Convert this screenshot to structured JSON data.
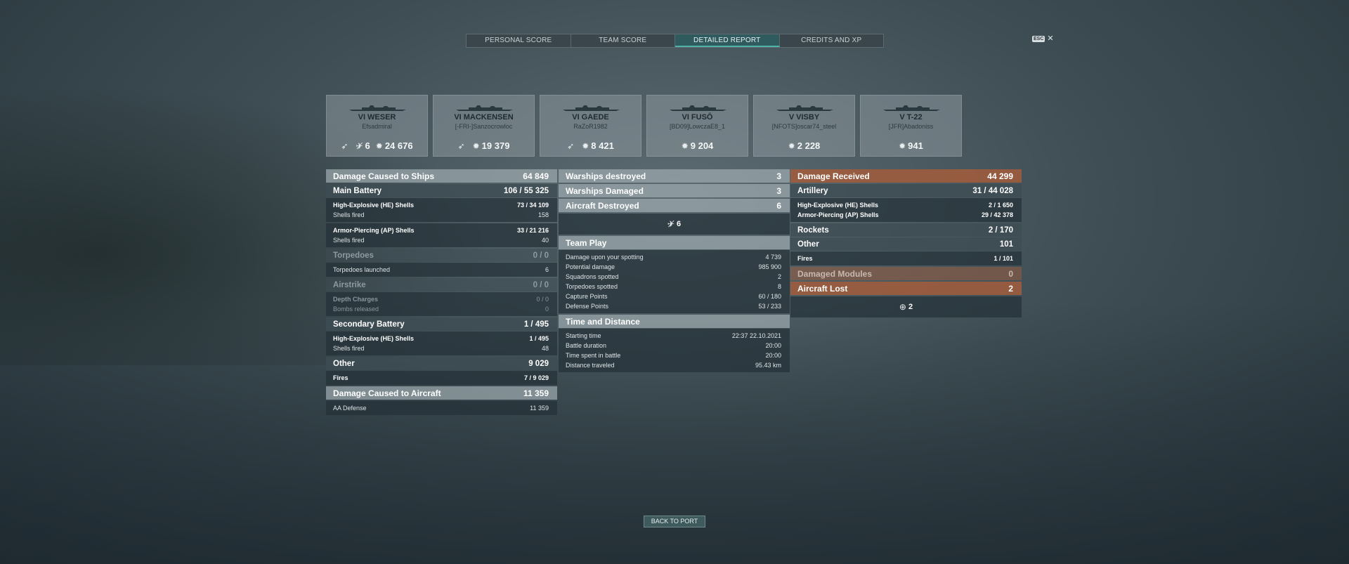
{
  "tabs": {
    "personal": "PERSONAL SCORE",
    "team": "TEAM SCORE",
    "detailed": "DETAILED REPORT",
    "credits": "CREDITS AND XP"
  },
  "esc": {
    "key": "ESC",
    "icon": "close-icon"
  },
  "ships": [
    {
      "tier": "VI",
      "name": "WESER",
      "player": "Efsadmiral",
      "stats": [
        {
          "icon": "torpedo-icon",
          "value": ""
        },
        {
          "icon": "plane-destroyed-icon",
          "value": "6"
        },
        {
          "icon": "damage-icon",
          "value": "24 676"
        }
      ]
    },
    {
      "tier": "VI",
      "name": "MACKENSEN",
      "player": "[-FRI-]Sanzocrowloc",
      "stats": [
        {
          "icon": "torpedo-icon",
          "value": ""
        },
        {
          "icon": "damage-icon",
          "value": "19 379"
        }
      ]
    },
    {
      "tier": "VI",
      "name": "GAEDE",
      "player": "RaZoR1982",
      "stats": [
        {
          "icon": "torpedo-icon",
          "value": ""
        },
        {
          "icon": "damage-icon",
          "value": "8 421"
        }
      ]
    },
    {
      "tier": "VI",
      "name": "FUSŌ",
      "player": "[BD09]LowczaE8_1",
      "stats": [
        {
          "icon": "damage-icon",
          "value": "9 204"
        }
      ]
    },
    {
      "tier": "V",
      "name": "VISBY",
      "player": "[NFOTS]oscar74_steel",
      "stats": [
        {
          "icon": "damage-icon",
          "value": "2 228"
        }
      ]
    },
    {
      "tier": "V",
      "name": "T-22",
      "player": "[JFR]Abadoniss",
      "stats": [
        {
          "icon": "damage-icon",
          "value": "941"
        }
      ]
    }
  ],
  "left": {
    "damage_ships": {
      "label": "Damage Caused to Ships",
      "value": "64 849"
    },
    "main_battery": {
      "label": "Main Battery",
      "hits": "106 / ",
      "dmg": "55 325"
    },
    "he_shells": {
      "label": "High-Explosive (HE) Shells",
      "hits": "73 / ",
      "dmg": "34 109"
    },
    "he_fired": {
      "label": "Shells fired",
      "value": "158"
    },
    "ap_shells": {
      "label": "Armor-Piercing (AP) Shells",
      "hits": "33 / ",
      "dmg": "21 216"
    },
    "ap_fired": {
      "label": "Shells fired",
      "value": "40"
    },
    "torpedoes": {
      "label": "Torpedoes",
      "value": "0 / 0"
    },
    "torps_launched": {
      "label": "Torpedoes launched",
      "value": "6"
    },
    "airstrike": {
      "label": "Airstrike",
      "value": "0 / 0"
    },
    "depth_charges": {
      "label": "Depth Charges",
      "value": "0 / 0"
    },
    "bombs_released": {
      "label": "Bombs released",
      "value": "0"
    },
    "secondary": {
      "label": "Secondary Battery",
      "hits": "1 / ",
      "dmg": "495"
    },
    "sec_he": {
      "label": "High-Explosive (HE) Shells",
      "hits": "1 / ",
      "dmg": "495"
    },
    "sec_fired": {
      "label": "Shells fired",
      "value": "48"
    },
    "other": {
      "label": "Other",
      "value": "9 029"
    },
    "fires": {
      "label": "Fires",
      "hits": "7 / ",
      "dmg": "9 029"
    },
    "damage_aircraft": {
      "label": "Damage Caused to Aircraft",
      "value": "11 359"
    },
    "aa_defense": {
      "label": "AA Defense",
      "value": "11 359"
    }
  },
  "mid": {
    "warships_destroyed": {
      "label": "Warships destroyed",
      "value": "3"
    },
    "warships_damaged": {
      "label": "Warships Damaged",
      "value": "3"
    },
    "aircraft_destroyed": {
      "label": "Aircraft Destroyed",
      "value": "6"
    },
    "aircraft_icon_count": "6",
    "team_play": "Team Play",
    "team_rows": [
      {
        "label": "Damage upon your spotting",
        "value": "4 739"
      },
      {
        "label": "Potential damage",
        "value": "985 900"
      },
      {
        "label": "Squadrons spotted",
        "value": "2"
      },
      {
        "label": "Torpedoes spotted",
        "value": "8"
      },
      {
        "label": "Capture Points",
        "value": "60 / 180"
      },
      {
        "label": "Defense Points",
        "value": "53 / 233"
      }
    ],
    "time_distance": "Time and Distance",
    "time_rows": [
      {
        "label": "Starting time",
        "value": "22:37  22.10.2021"
      },
      {
        "label": "Battle duration",
        "value": "20:00"
      },
      {
        "label": "Time spent in battle",
        "value": "20:00"
      },
      {
        "label": "Distance traveled",
        "value": "95.43 km"
      }
    ]
  },
  "right": {
    "damage_received": {
      "label": "Damage Received",
      "value": "44 299"
    },
    "artillery": {
      "label": "Artillery",
      "hits": "31 / ",
      "dmg": "44 028"
    },
    "he_shells": {
      "label": "High-Explosive (HE) Shells",
      "hits": "2 / ",
      "dmg": "1 650"
    },
    "ap_shells": {
      "label": "Armor-Piercing (AP) Shells",
      "hits": "29 / ",
      "dmg": "42 378"
    },
    "rockets": {
      "label": "Rockets",
      "hits": "2 / ",
      "dmg": "170"
    },
    "other": {
      "label": "Other",
      "value": "101"
    },
    "fires": {
      "label": "Fires",
      "hits": "1 / ",
      "dmg": "101"
    },
    "damaged_modules": {
      "label": "Damaged Modules",
      "value": "0"
    },
    "aircraft_lost": {
      "label": "Aircraft Lost",
      "value": "2"
    },
    "lost_icon_count": "2"
  },
  "back_button": "BACK TO PORT"
}
